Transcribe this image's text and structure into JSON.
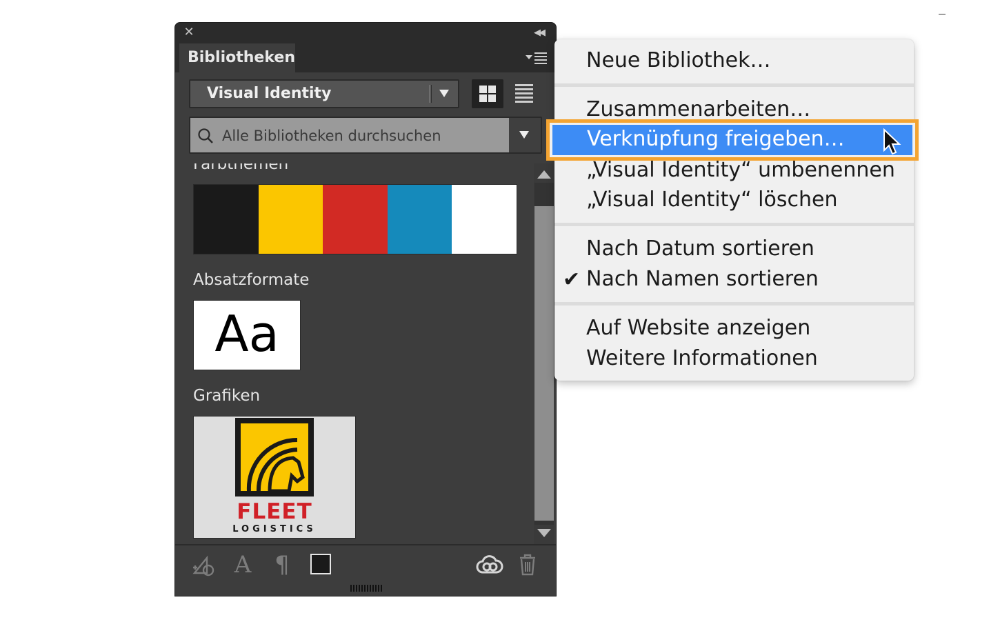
{
  "panel": {
    "tab_label": "Bibliotheken",
    "library_select": "Visual Identity",
    "search_placeholder": "Alle Bibliotheken durchsuchen",
    "sections": {
      "colors": {
        "title": "Farbthemen",
        "swatches": [
          "#1a1a1a",
          "#fbc600",
          "#d22a24",
          "#158abb",
          "#ffffff"
        ]
      },
      "paragraph_styles": {
        "title": "Absatzformate",
        "sample": "Aa"
      },
      "graphics": {
        "title": "Grafiken",
        "logo_word": "FLEET",
        "logo_sub": "LOGISTICS"
      }
    },
    "footer_icons": [
      "add-graphic-icon",
      "character-style-icon",
      "paragraph-style-icon",
      "fill-color-icon",
      "creative-cloud-icon",
      "trash-icon"
    ]
  },
  "menu": {
    "items": {
      "new_library": "Neue Bibliothek…",
      "collaborate": "Zusammenarbeiten…",
      "share_link": "Verknüpfung freigeben…",
      "rename": "„Visual Identity“ umbenennen",
      "delete": "„Visual Identity“ löschen",
      "sort_date": "Nach Datum sortieren",
      "sort_name": "Nach Namen sortieren",
      "view_website": "Auf Website anzeigen",
      "more_info": "Weitere Informationen"
    },
    "checked_item": "sort_name",
    "highlight_color": "#3d8cf5",
    "highlight_border_color": "#f4a432"
  }
}
